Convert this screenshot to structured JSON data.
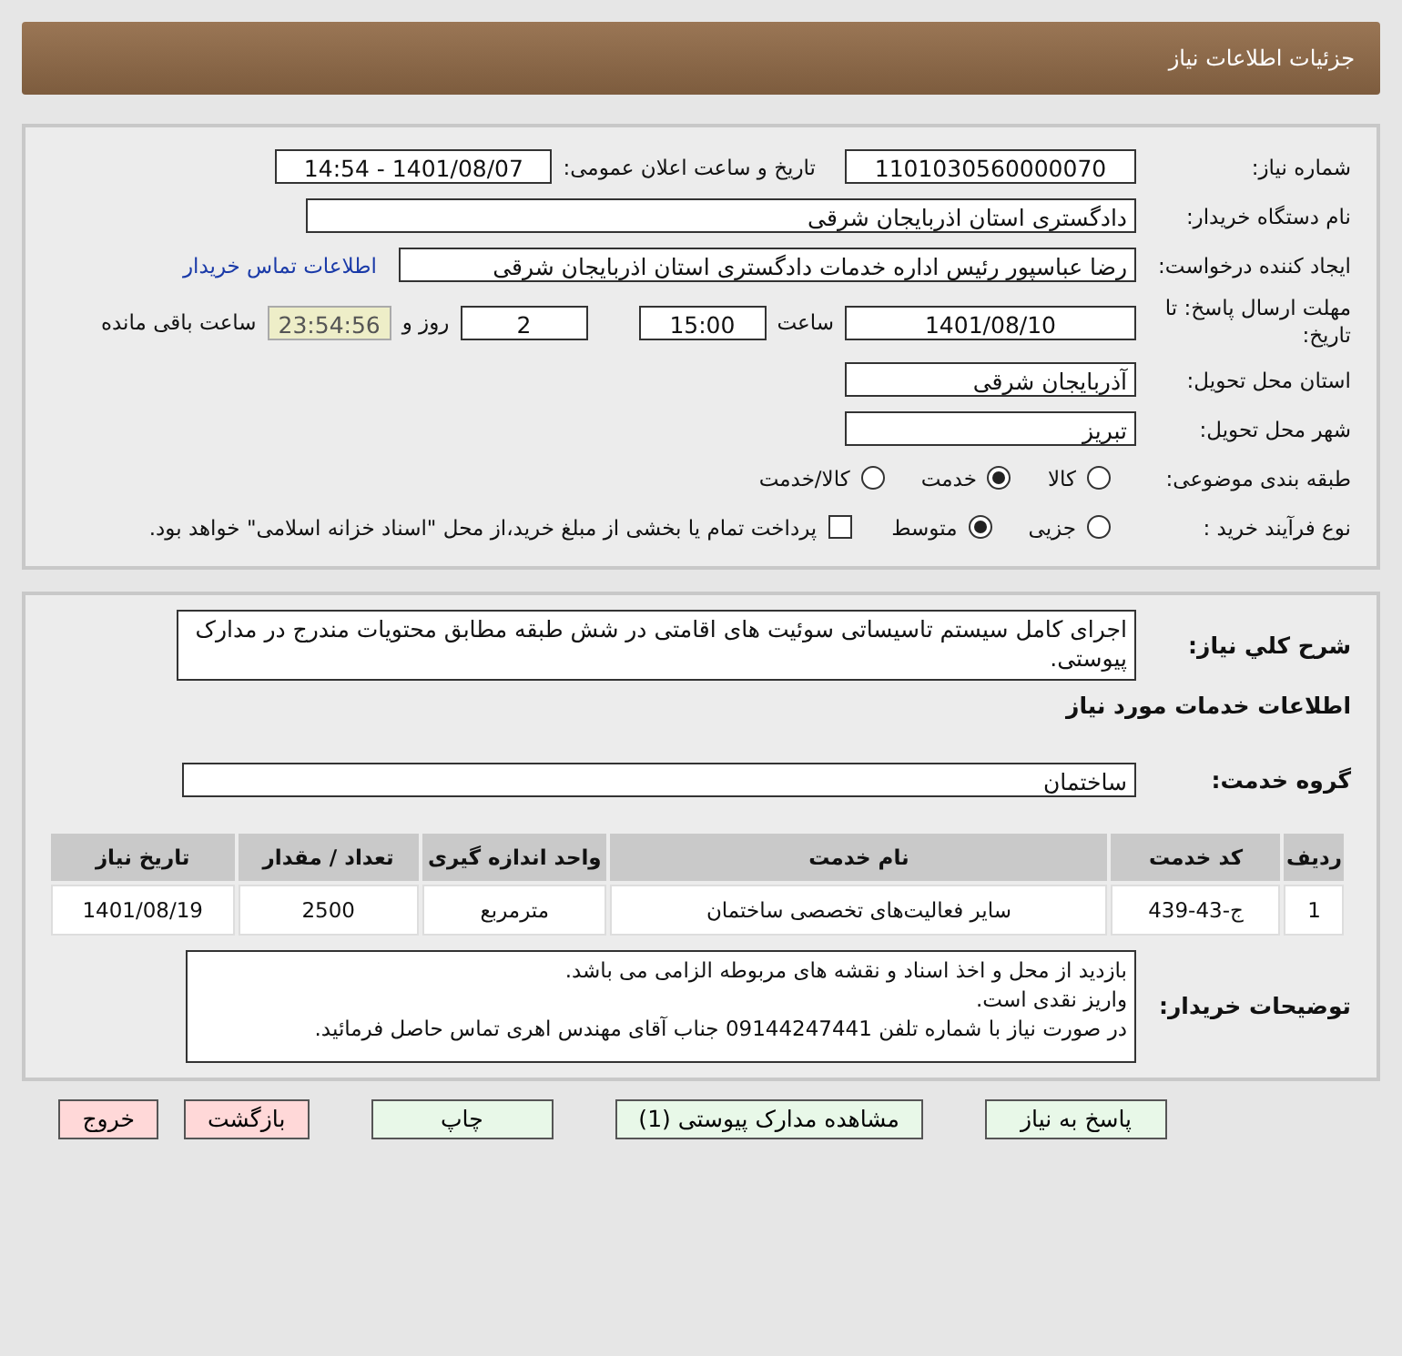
{
  "header": {
    "title": "جزئیات اطلاعات نیاز"
  },
  "details": {
    "need_number": {
      "label": "شماره نیاز:",
      "value": "1101030560000070"
    },
    "announce": {
      "label": "تاریخ و ساعت اعلان عمومی:",
      "value": "1401/08/07 - 14:54"
    },
    "buyer_org": {
      "label": "نام دستگاه خریدار:",
      "value": "دادگستری استان اذربایجان شرقی"
    },
    "creator": {
      "label": "ایجاد کننده درخواست:",
      "value": "رضا عباسپور رئیس اداره خدمات دادگستری استان اذربایجان شرقی",
      "link": "اطلاعات تماس خریدار"
    },
    "deadline": {
      "label": "مهلت ارسال پاسخ: تا تاریخ:",
      "date": "1401/08/10",
      "time_label": "ساعت",
      "time": "15:00",
      "days": "2",
      "days_label": "روز و",
      "remaining": "23:54:56",
      "remaining_label": "ساعت باقی مانده"
    },
    "province": {
      "label": "استان محل تحویل:",
      "value": "آذربایجان شرقی"
    },
    "city": {
      "label": "شهر محل تحویل:",
      "value": "تبریز"
    },
    "category": {
      "label": "طبقه بندی موضوعی:",
      "options": [
        {
          "label": "کالا",
          "selected": false
        },
        {
          "label": "خدمت",
          "selected": true
        },
        {
          "label": "کالا/خدمت",
          "selected": false
        }
      ]
    },
    "process": {
      "label": "نوع فرآیند خرید :",
      "options": [
        {
          "label": "جزیی",
          "selected": false
        },
        {
          "label": "متوسط",
          "selected": true
        }
      ],
      "treasury": {
        "checked": false,
        "label": "پرداخت تمام یا بخشی از مبلغ خرید،از محل \"اسناد خزانه اسلامی\" خواهد بود."
      }
    }
  },
  "services": {
    "summary": {
      "label": "شرح کلي نیاز:",
      "value": "اجرای کامل سیستم تاسیساتی سوئیت های اقامتی در شش طبقه مطابق محتویات مندرج در مدارک پیوستی."
    },
    "heading": "اطلاعات خدمات مورد نیاز",
    "group": {
      "label": "گروه خدمت:",
      "value": "ساختمان"
    },
    "table": {
      "columns": [
        "ردیف",
        "کد خدمت",
        "نام خدمت",
        "واحد اندازه گیری",
        "تعداد / مقدار",
        "تاریخ نیاز"
      ],
      "rows": [
        [
          "1",
          "ج-43-439",
          "سایر فعالیت‌های تخصصی ساختمان",
          "مترمربع",
          "2500",
          "1401/08/19"
        ]
      ]
    },
    "buyer_notes": {
      "label": "توضیحات خریدار:",
      "lines": [
        "بازدید از محل و اخذ اسناد و نقشه های مربوطه الزامی می باشد.",
        "واریز نقدی است.",
        "در صورت نیاز با شماره تلفن 09144247441 جناب آقای مهندس اهری تماس حاصل فرمائید."
      ]
    }
  },
  "buttons": [
    {
      "label": "پاسخ به نیاز",
      "kind": "action"
    },
    {
      "label": "مشاهده مدارک پیوستی (1)",
      "kind": "action"
    },
    {
      "label": "چاپ",
      "kind": "action"
    },
    {
      "label": "بازگشت",
      "kind": "exit"
    },
    {
      "label": "خروج",
      "kind": "exit"
    }
  ]
}
